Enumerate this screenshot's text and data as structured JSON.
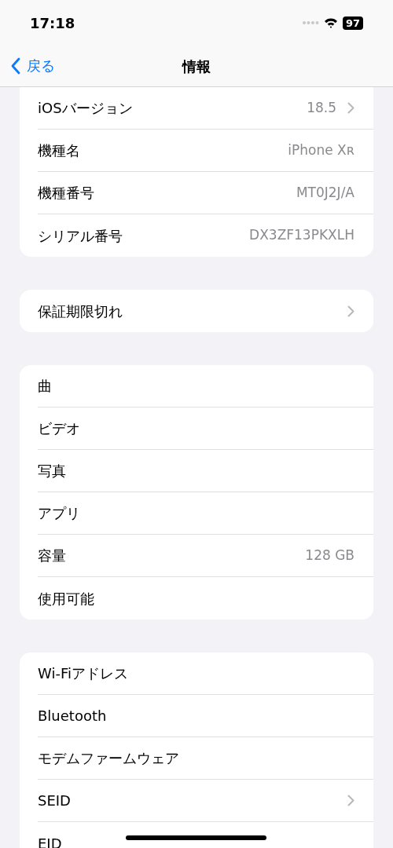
{
  "status_bar": {
    "time": "17:18",
    "battery": "97"
  },
  "nav": {
    "back": "戻る",
    "title": "情報"
  },
  "groups": [
    {
      "rows": [
        {
          "label": "iOSバージョン",
          "value": "18.5",
          "chevron": true
        },
        {
          "label": "機種名",
          "value": "iPhone Xʀ",
          "chevron": false
        },
        {
          "label": "機種番号",
          "value": "MT0J2J/A",
          "chevron": false
        },
        {
          "label": "シリアル番号",
          "value": "DX3ZF13PKXLH",
          "chevron": false
        }
      ]
    },
    {
      "rows": [
        {
          "label": "保証期限切れ",
          "chevron": true
        }
      ]
    },
    {
      "rows": [
        {
          "label": "曲",
          "chevron": false
        },
        {
          "label": "ビデオ",
          "chevron": false
        },
        {
          "label": "写真",
          "chevron": false
        },
        {
          "label": "アプリ",
          "chevron": false
        },
        {
          "label": "容量",
          "value": "128 GB",
          "chevron": false
        },
        {
          "label": "使用可能",
          "chevron": false
        }
      ]
    },
    {
      "rows": [
        {
          "label": "Wi-Fiアドレス",
          "chevron": false
        },
        {
          "label": "Bluetooth",
          "chevron": false
        },
        {
          "label": "モデムファームウェア",
          "chevron": false
        },
        {
          "label": "SEID",
          "chevron": true
        },
        {
          "label": "EID",
          "chevron": false
        }
      ]
    }
  ]
}
